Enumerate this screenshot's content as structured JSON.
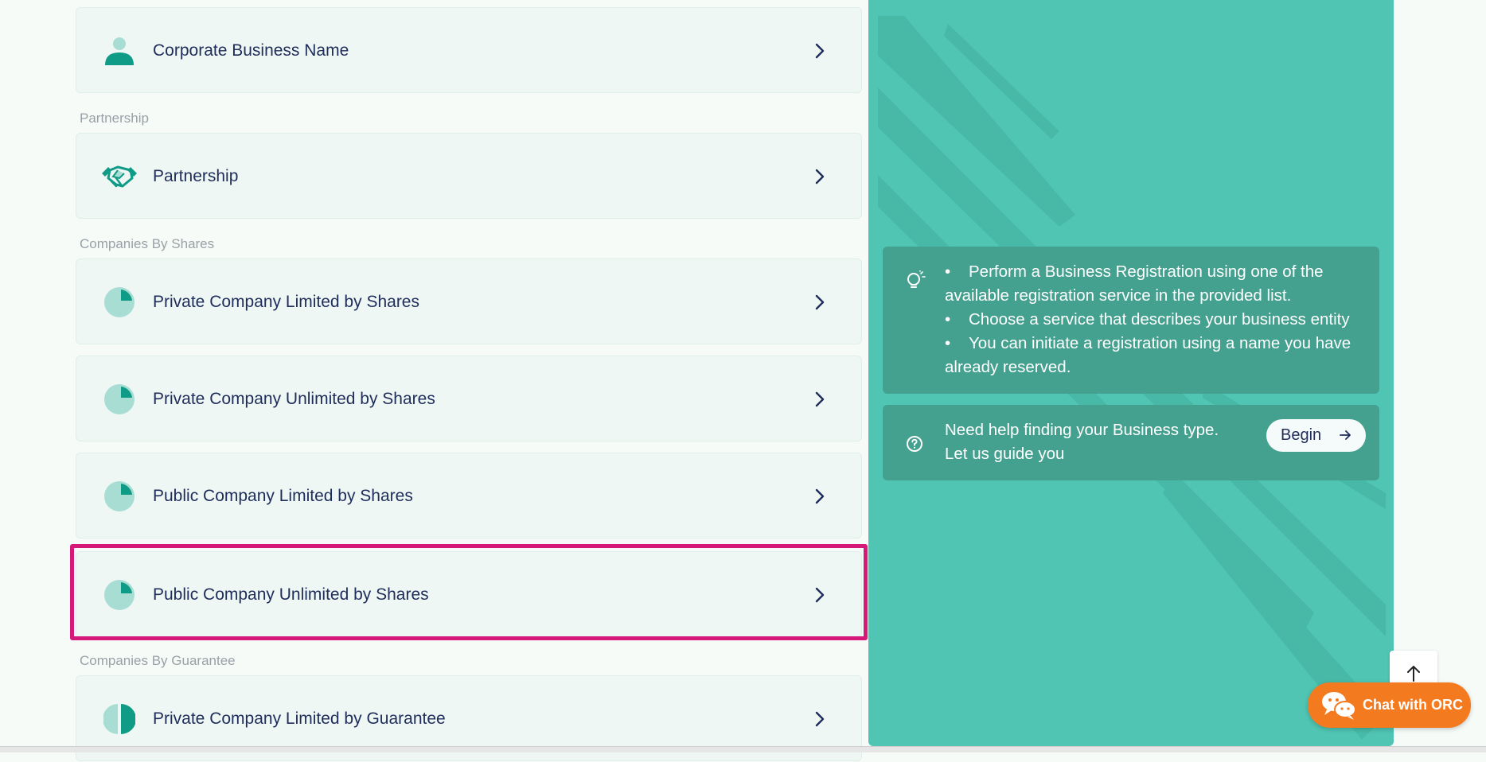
{
  "sections": {
    "partnership": "Partnership",
    "shares": "Companies By Shares",
    "guarantee": "Companies By Guarantee"
  },
  "cards": {
    "corporate": "Corporate Business Name",
    "partnership": "Partnership",
    "private_limited_shares": "Private Company Limited by Shares",
    "private_unlimited_shares": "Private Company Unlimited by Shares",
    "public_limited_shares": "Public Company Limited by Shares",
    "public_unlimited_shares": "Public Company Unlimited by Shares",
    "private_limited_guarantee": "Private Company Limited by Guarantee"
  },
  "info": {
    "bullets": [
      "Perform a Business Registration using one of the available registration service in the provided list.",
      "Choose a service that describes your business entity",
      "You can initiate a registration using a name you have already reserved."
    ]
  },
  "help": {
    "line1": "Need help finding your Business type.",
    "line2": "Let us guide you",
    "button": "Begin"
  },
  "chat": {
    "label": "Chat with ORC"
  },
  "colors": {
    "accent": "#0f9b86",
    "panel": "#50c5b3",
    "highlight": "#d4197a",
    "chat": "#f47a20"
  }
}
